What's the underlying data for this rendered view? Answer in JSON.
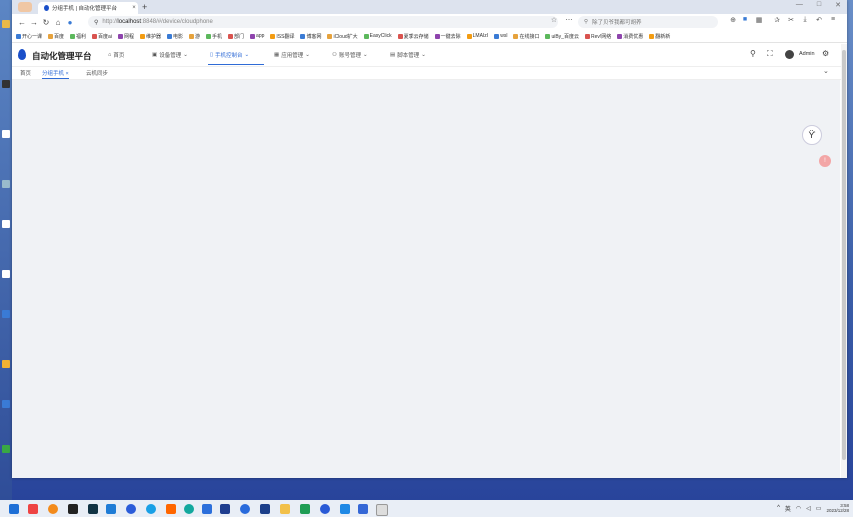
{
  "browser": {
    "tab_title": "分组手机 | 自动化管理平台",
    "tab_close": "×",
    "new_tab": "+",
    "url_prefix": "http://",
    "url_host": "localhost",
    "url_rest": ":8848/#/device/cloudphone",
    "search_placeholder": "除了贝爷我都可胡养",
    "bookmarks": [
      "开心一课",
      "百度",
      "福利",
      "百度ai",
      "网程",
      "维护器",
      "电影",
      "游",
      "手机",
      "部门",
      "app",
      "ISS翻译",
      "博客网",
      "iCloud扩大",
      "EasyClick",
      "夏季云存储",
      "一键去除",
      "LMAIzI",
      "wsl",
      "在线接口",
      "uiBy_百度云",
      "Rev!网络",
      "消费优惠",
      "翻新新"
    ]
  },
  "app": {
    "brand": "自动化管理平台",
    "menus": [
      {
        "label": "首页"
      },
      {
        "label": "设备管理"
      },
      {
        "label": "手机控制台"
      },
      {
        "label": "应用管理"
      },
      {
        "label": "账号管理"
      },
      {
        "label": "脚本管理"
      }
    ],
    "user": "Admin",
    "tags": [
      {
        "label": "首页"
      },
      {
        "label": "分组手机"
      },
      {
        "label": "云机同步"
      }
    ],
    "tag_close": "×",
    "chevron": "⌄",
    "dd": "⌄"
  },
  "taskbar": {
    "tray_lang": "英",
    "time": "3:58",
    "date": "2023/12/28"
  },
  "colors": {
    "accent": "#2f6bd6",
    "brand_logo": "#1a4fc9"
  }
}
